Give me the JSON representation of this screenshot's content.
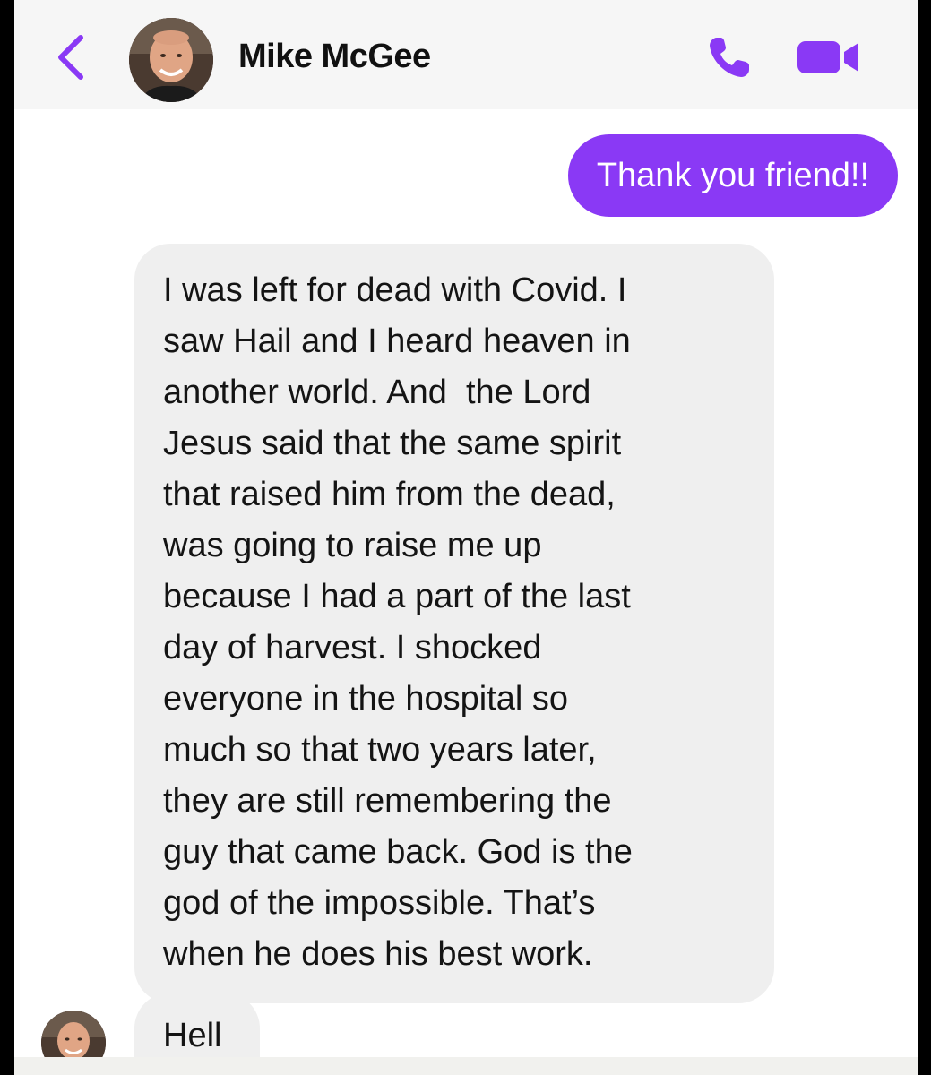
{
  "header": {
    "contact_name": "Mike McGee",
    "back_icon": "chevron-left-icon",
    "call_icon": "phone-icon",
    "video_icon": "video-camera-icon",
    "accent_color": "#8a39f5"
  },
  "messages": [
    {
      "direction": "outgoing",
      "text": "Thank you friend!!"
    },
    {
      "direction": "incoming",
      "text": "I was left for dead with Covid. I\nsaw Hail and I heard heaven in\nanother world. And  the Lord\nJesus said that the same spirit\nthat raised him from the dead,\nwas going to raise me up\nbecause I had a part of the last\nday of harvest. I shocked\neveryone in the hospital so\nmuch so that two years later,\nthey are still remembering the\nguy that came back. God is the\ngod of the impossible. That’s\nwhen he does his best work."
    },
    {
      "direction": "incoming",
      "text": "Hell"
    }
  ]
}
